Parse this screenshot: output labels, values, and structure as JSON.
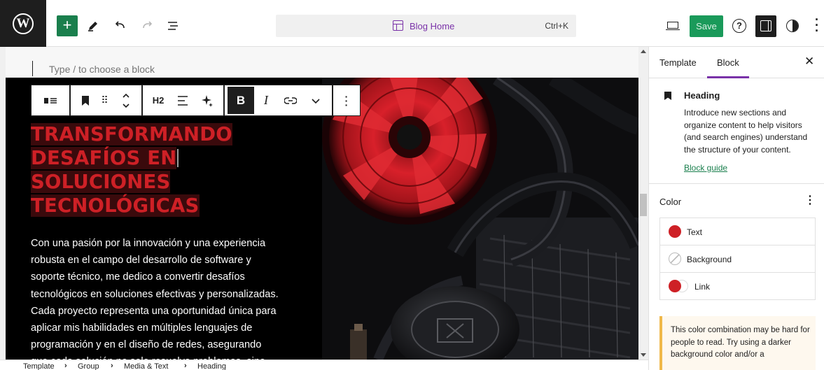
{
  "header": {
    "save_label": "Save",
    "command_bar": {
      "title": "Blog Home",
      "shortcut": "Ctrl+K"
    }
  },
  "canvas": {
    "placeholder": "Type / to choose a block",
    "heading_lines": [
      "TRANSFORMANDO",
      "DESAFÍOS EN",
      "SOLUCIONES",
      "TECNOLÓGICAS"
    ],
    "paragraph_lines": [
      "Con una pasión por la innovación y una experiencia",
      "robusta en el campo del desarrollo de software y",
      "soporte técnico, me dedico a convertir desafíos",
      "tecnológicos en soluciones efectivas y personalizadas.",
      "Cada proyecto representa una oportunidad única para",
      "aplicar mis habilidades en múltiples lenguajes de",
      "programación y en el diseño de redes, asegurando",
      "que cada solución no solo resuelva problemas, sino"
    ],
    "heading_color": "#ce2026"
  },
  "toolbar": {
    "heading_level": "H2",
    "bold": "B",
    "italic": "I"
  },
  "breadcrumb": [
    "Template",
    "Group",
    "Media & Text",
    "Heading"
  ],
  "sidebar": {
    "tabs": [
      "Template",
      "Block"
    ],
    "active_tab": "Block",
    "block": {
      "title": "Heading",
      "description": "Introduce new sections and organize content to help visitors (and search engines) understand the structure of your content.",
      "guide_link": "Block guide"
    },
    "color": {
      "title": "Color",
      "items": [
        {
          "label": "Text"
        },
        {
          "label": "Background"
        },
        {
          "label": "Link"
        }
      ]
    },
    "notice": "This color combination may be hard for people to read. Try using a darker background color and/or a"
  },
  "colors": {
    "accent": "#7a32a8",
    "save": "#1a9a5a",
    "add": "#1a7f4d"
  }
}
